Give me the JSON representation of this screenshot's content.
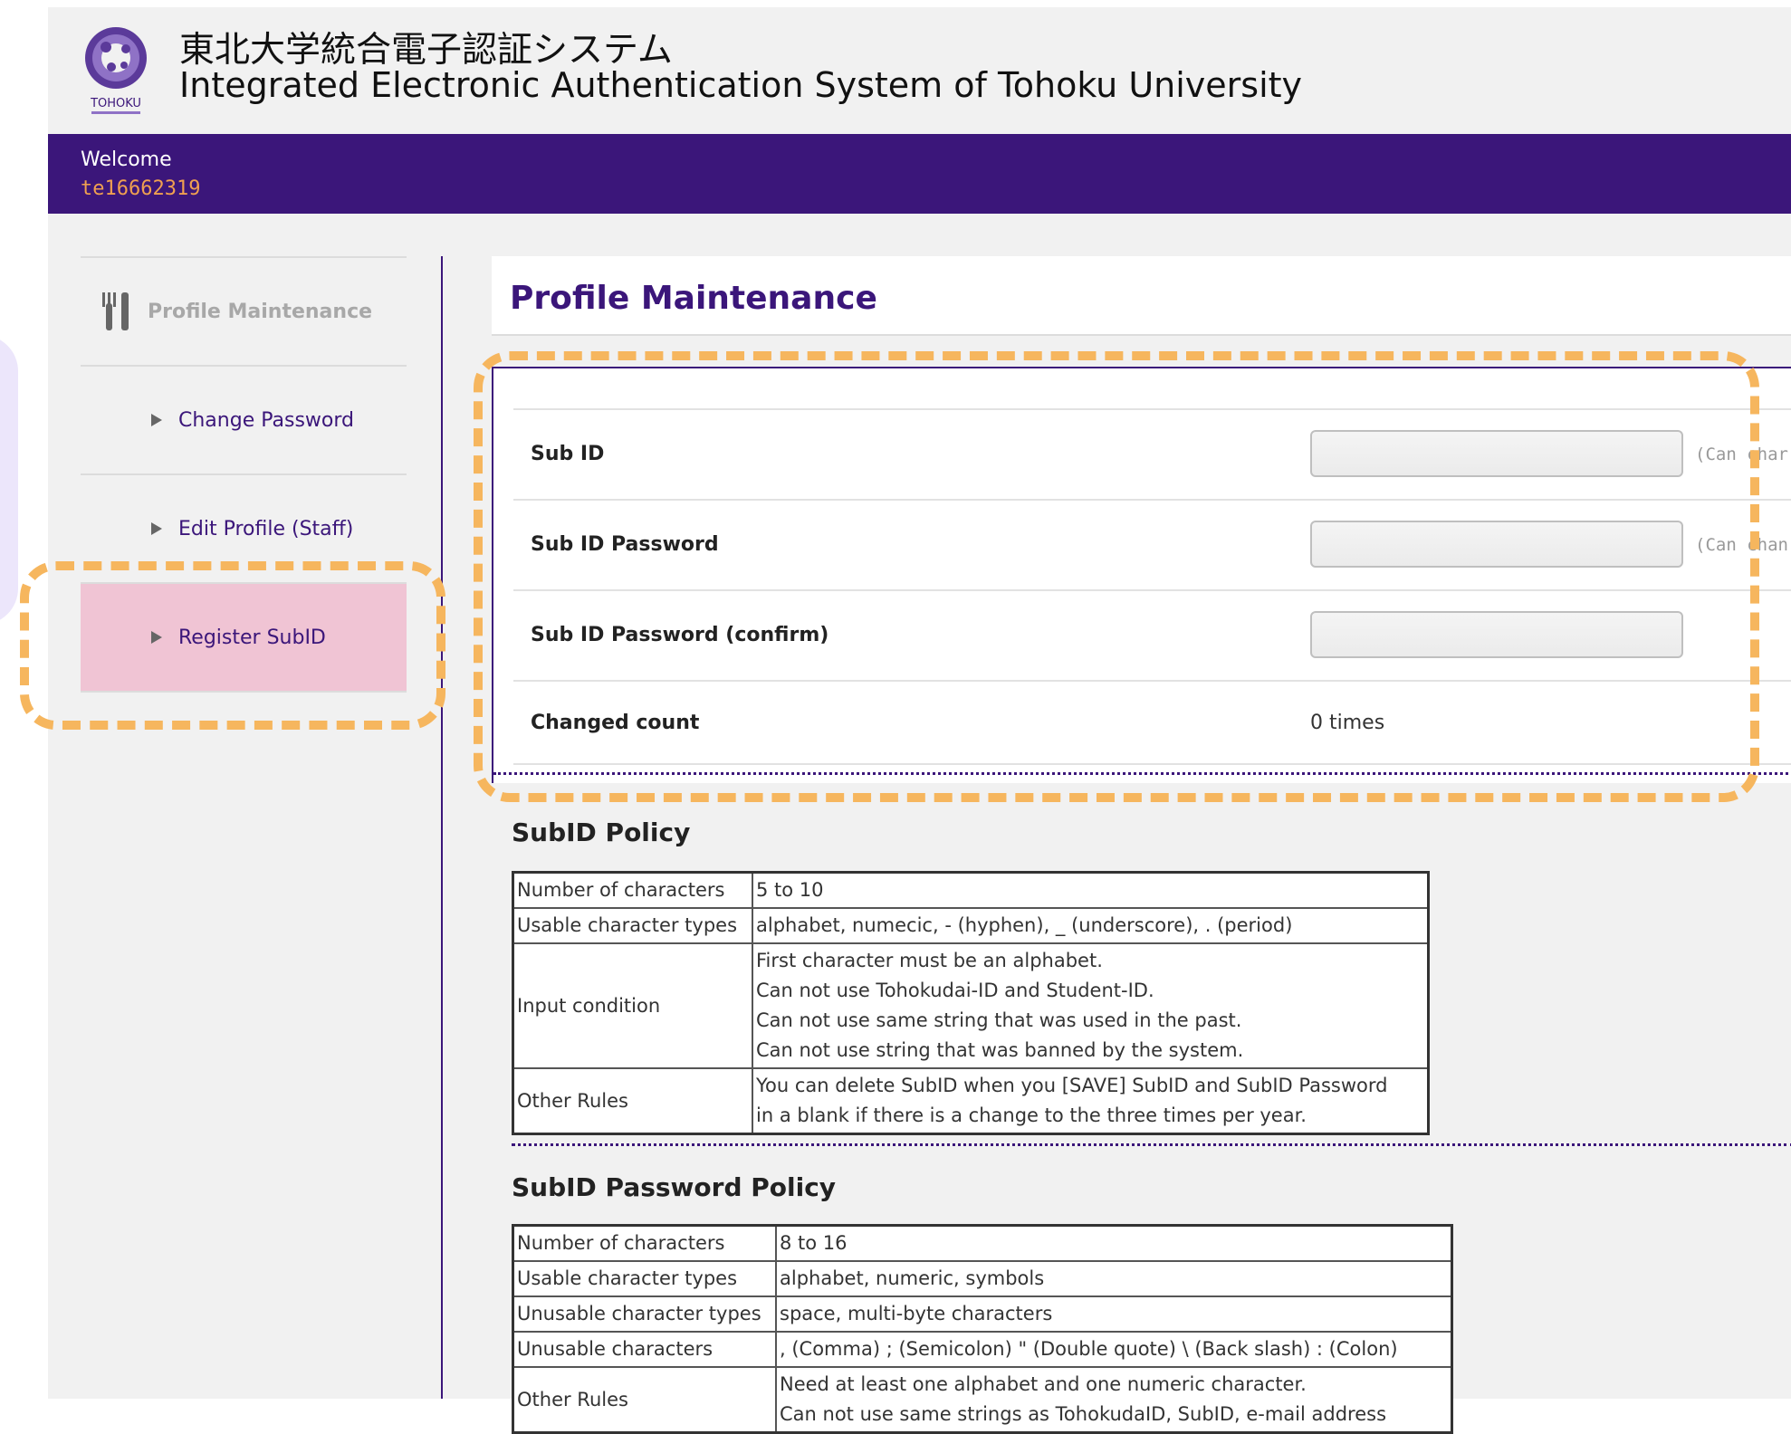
{
  "header": {
    "title_ja": "東北大学統合電子認証システム",
    "title_en": "Integrated Electronic Authentication System of Tohoku University",
    "logo_text": "TOHOKU"
  },
  "welcome": {
    "label": "Welcome",
    "user": "te16662319"
  },
  "sidebar": {
    "heading": "Profile Maintenance",
    "items": [
      {
        "label": "Change Password"
      },
      {
        "label": "Edit Profile (Staff)"
      },
      {
        "label": "Register SubID"
      }
    ]
  },
  "main": {
    "title": "Profile Maintenance",
    "form": {
      "sub_id_label": "Sub ID",
      "sub_id_hint": "(Can char",
      "sub_id_password_label": "Sub ID Password",
      "sub_id_password_hint": "(Can chan",
      "sub_id_password_confirm_label": "Sub ID Password (confirm)",
      "changed_count_label": "Changed count",
      "changed_count_value": "0 times"
    },
    "subid_policy": {
      "title": "SubID Policy",
      "rows": [
        {
          "key": "Number of characters",
          "values": [
            "5 to 10"
          ]
        },
        {
          "key": "Usable character types",
          "values": [
            "alphabet, numecic, - (hyphen), _ (underscore), . (period)"
          ]
        },
        {
          "key": "Input condition",
          "values": [
            "First character must be an alphabet.",
            "Can not use Tohokudai-ID and Student-ID.",
            "Can not use same string that was used in the past.",
            "Can not use string that was banned by the system."
          ]
        },
        {
          "key": "Other Rules",
          "values": [
            "You can delete SubID when you [SAVE] SubID and SubID Password",
            "in a blank if there is a change to the three times per year."
          ]
        }
      ]
    },
    "password_policy": {
      "title": "SubID Password Policy",
      "rows": [
        {
          "key": "Number of characters",
          "values": [
            "8 to 16"
          ]
        },
        {
          "key": "Usable character types",
          "values": [
            "alphabet, numeric, symbols"
          ]
        },
        {
          "key": "Unusable character types",
          "values": [
            "space, multi-byte characters"
          ]
        },
        {
          "key": "Unusable characters",
          "values": [
            " , (Comma) ; (Semicolon) \" (Double quote) \\ (Back slash) : (Colon)"
          ]
        },
        {
          "key": "Other Rules",
          "values": [
            "Need at least one alphabet and one numeric character.",
            "Can not use same strings as TohokudaID, SubID, e-mail address"
          ]
        }
      ]
    }
  },
  "colors": {
    "brand": "#3b167a",
    "highlight": "#f6b65e",
    "active_item": "#f0c4d4",
    "user": "#f0a050"
  }
}
